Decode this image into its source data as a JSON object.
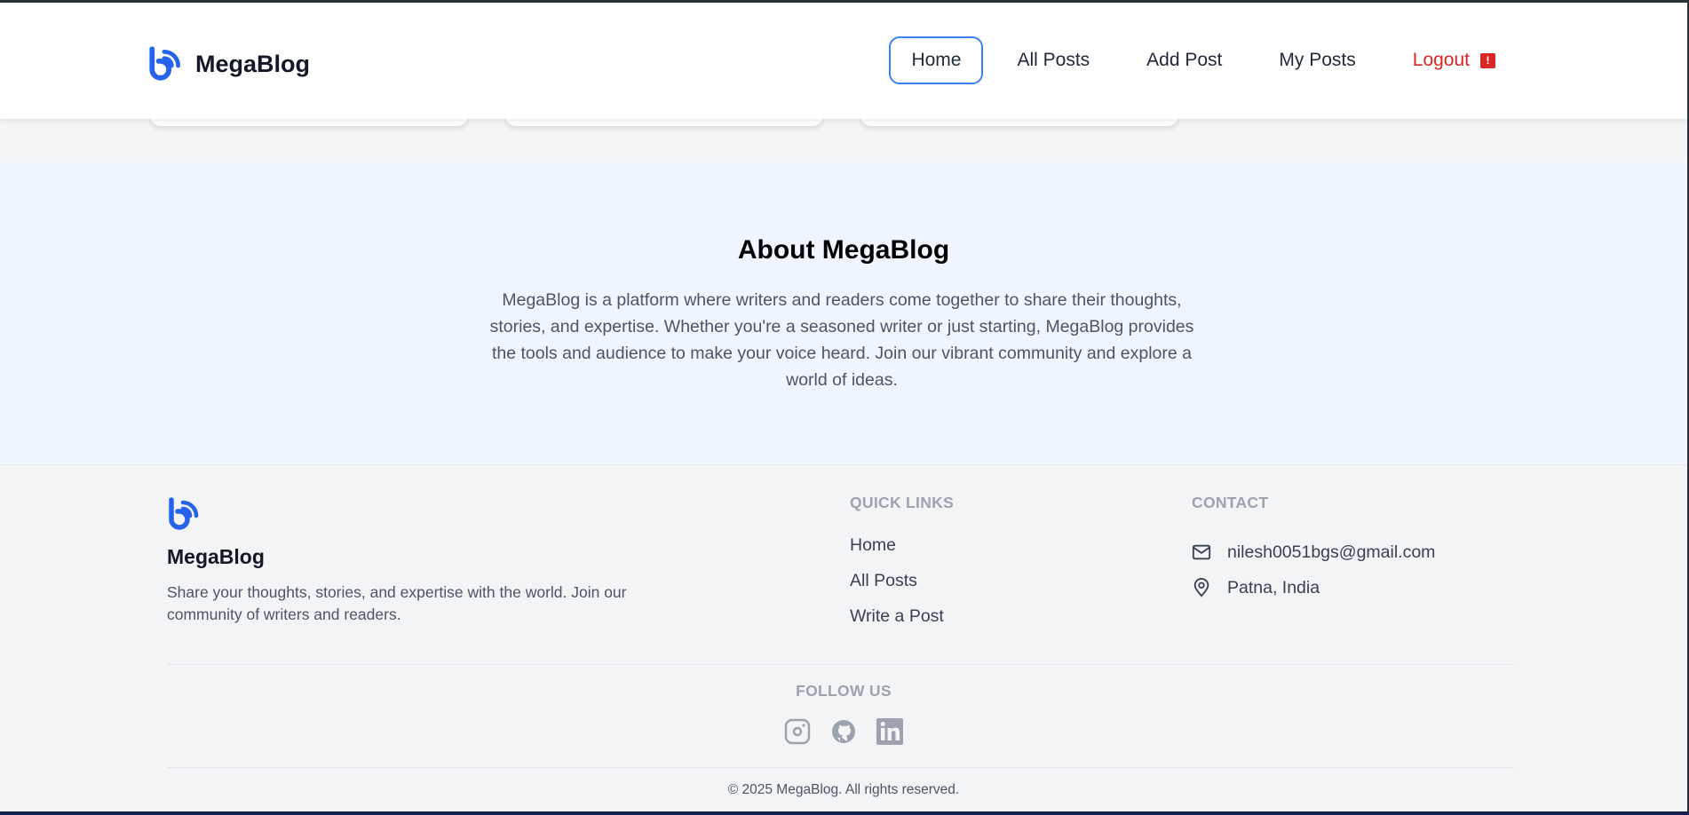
{
  "brand": {
    "name": "MegaBlog",
    "logo_icon": "megablog-logo-icon",
    "color": "#2563eb"
  },
  "nav": {
    "items": [
      {
        "label": "Home",
        "active": true
      },
      {
        "label": "All Posts"
      },
      {
        "label": "Add Post"
      },
      {
        "label": "My Posts"
      }
    ],
    "logout": {
      "label": "Logout",
      "badge": "!"
    }
  },
  "about": {
    "title": "About MegaBlog",
    "text": "MegaBlog is a platform where writers and readers come together to share their thoughts, stories, and expertise. Whether you're a seasoned writer or just starting, MegaBlog provides the tools and audience to make your voice heard. Join our vibrant community and explore a world of ideas."
  },
  "footer": {
    "brand": "MegaBlog",
    "description": "Share your thoughts, stories, and expertise with the world. Join our community of writers and readers.",
    "quick_links": {
      "heading": "QUICK LINKS",
      "items": [
        "Home",
        "All Posts",
        "Write a Post"
      ]
    },
    "contact": {
      "heading": "CONTACT",
      "email": "nilesh0051bgs@gmail.com",
      "location": "Patna, India"
    },
    "follow": {
      "heading": "FOLLOW US",
      "icons": [
        "instagram-icon",
        "github-icon",
        "linkedin-icon"
      ]
    },
    "copyright": "© 2025 MegaBlog. All rights reserved."
  },
  "colors": {
    "accent": "#3b82f6",
    "logout": "#dc2626",
    "about_bg": "#eff6ff",
    "footer_bg": "#f3f4f6"
  }
}
